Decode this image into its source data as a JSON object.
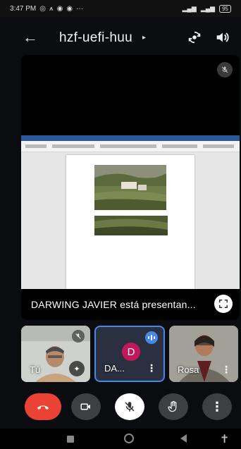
{
  "status_bar": {
    "time": "3:47 PM",
    "icons": [
      "instagram-icon",
      "alert-icon",
      "chrome-icon",
      "chrome-icon",
      "more-dots"
    ],
    "battery": "95"
  },
  "header": {
    "meeting_code": "hzf-uefi-huu",
    "caret": "▸"
  },
  "presentation": {
    "presenter_label": "DARWING JAVIER está presentan..."
  },
  "participants": [
    {
      "name": "Tú",
      "mic_muted": true
    },
    {
      "name": "DA...",
      "avatar_letter": "D",
      "avatar_color": "#c2185b",
      "speaking": true
    },
    {
      "name": "Rosa"
    }
  ],
  "controls": {
    "end_call_color": "#ea4335",
    "mic_muted": true
  },
  "colors": {
    "accent_blue": "#4a86e8",
    "word_ribbon": "#2b579a"
  }
}
